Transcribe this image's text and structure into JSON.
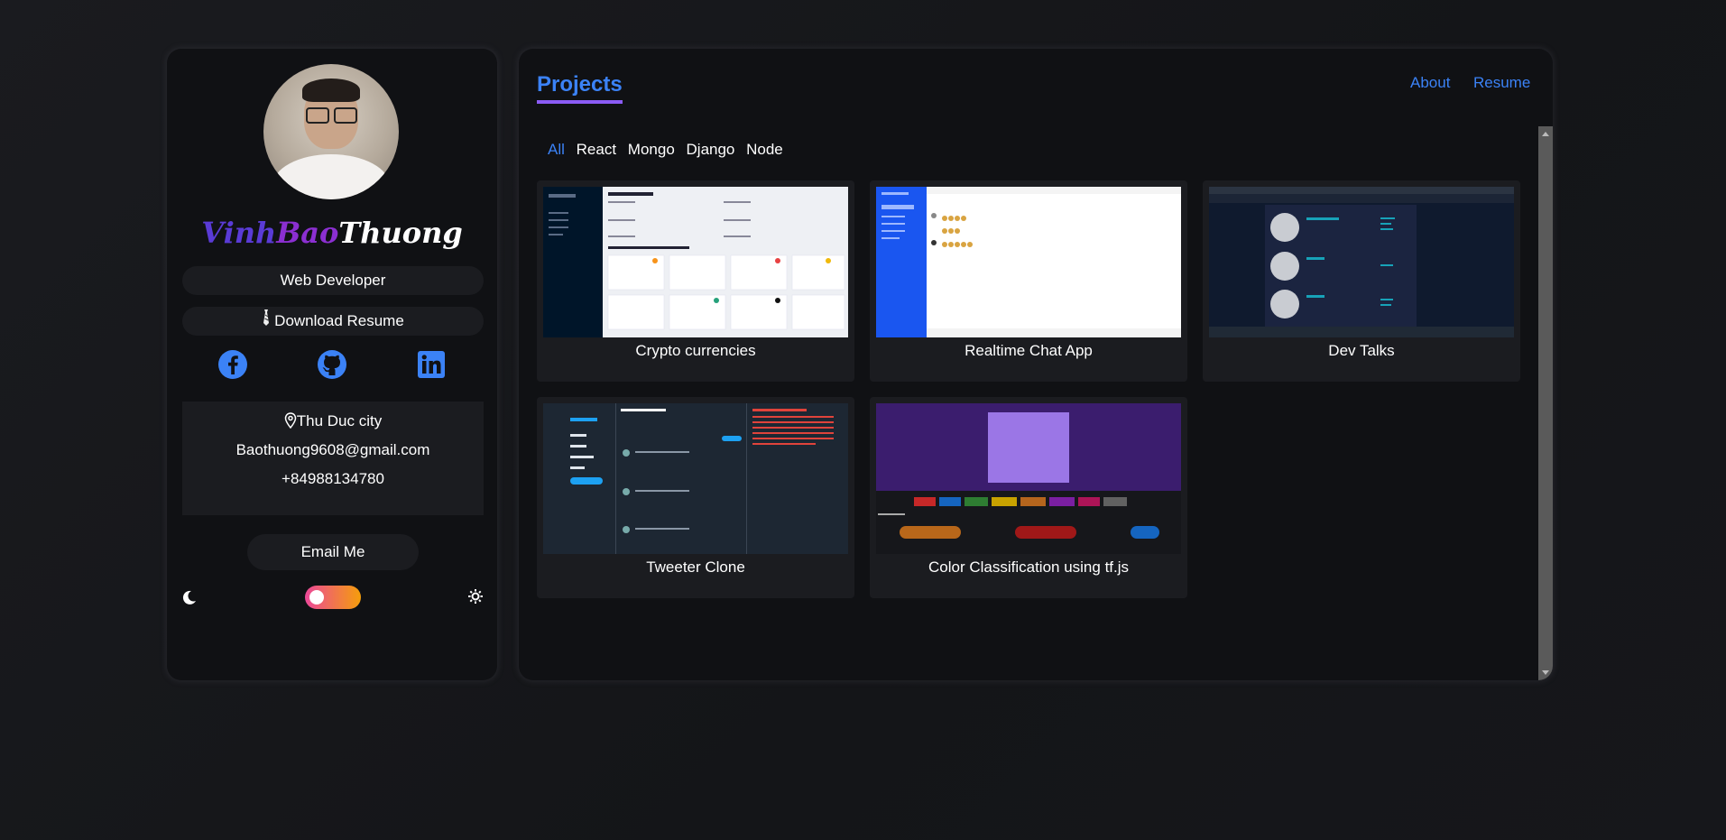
{
  "profile": {
    "name_part1": "Vinh",
    "name_part2": "Bao",
    "name_part3": "Thuong",
    "role": "Web Developer",
    "download_label": "Download Resume",
    "location": "Thu Duc city",
    "email": "Baothuong9608@gmail.com",
    "phone": "+84988134780",
    "email_button": "Email Me",
    "socials": [
      "facebook-icon",
      "github-icon",
      "linkedin-icon"
    ],
    "theme_toggle": "light-dark",
    "accent": "#3b82f6"
  },
  "main": {
    "title": "Projects",
    "nav": [
      "About",
      "Resume"
    ],
    "filters": [
      "All",
      "React",
      "Mongo",
      "Django",
      "Node"
    ],
    "active_filter": "All",
    "projects": [
      {
        "label": "Crypto currencies"
      },
      {
        "label": "Realtime Chat App"
      },
      {
        "label": "Dev Talks"
      },
      {
        "label": "Tweeter Clone"
      },
      {
        "label": "Color Classification using tf.js"
      }
    ]
  }
}
